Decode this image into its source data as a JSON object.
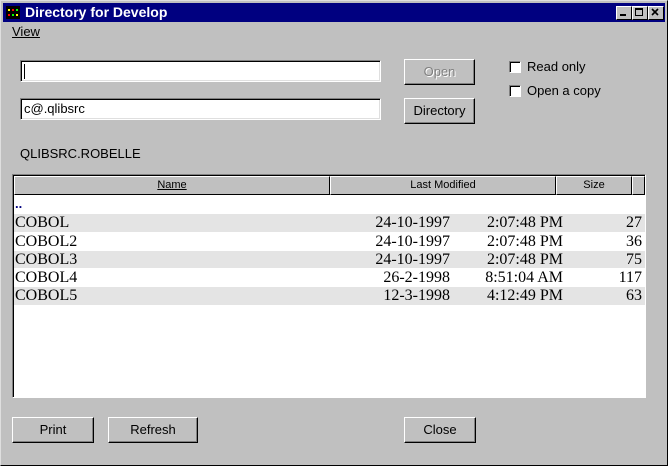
{
  "window": {
    "title": "Directory for Develop"
  },
  "menu": {
    "view_label": "View"
  },
  "inputs": {
    "file_value": "",
    "directory_value": "c@.qlibsrc"
  },
  "buttons": {
    "open": "Open",
    "directory": "Directory",
    "print": "Print",
    "refresh": "Refresh",
    "close": "Close"
  },
  "checkboxes": {
    "read_only": {
      "label": "Read only",
      "checked": false
    },
    "open_copy": {
      "label": "Open a copy",
      "checked": false
    }
  },
  "path_label": "QLIBSRC.ROBELLE",
  "list": {
    "headers": {
      "name": "Name",
      "modified": "Last Modified",
      "size": "Size"
    },
    "parent_entry": "..",
    "rows": [
      {
        "name": "COBOL",
        "date": "24-10-1997",
        "time": "2:07:48 PM",
        "size": "27"
      },
      {
        "name": "COBOL2",
        "date": "24-10-1997",
        "time": "2:07:48 PM",
        "size": "36"
      },
      {
        "name": "COBOL3",
        "date": "24-10-1997",
        "time": "2:07:48 PM",
        "size": "75"
      },
      {
        "name": "COBOL4",
        "date": "26-2-1998",
        "time": "8:51:04 AM",
        "size": "117"
      },
      {
        "name": "COBOL5",
        "date": "12-3-1998",
        "time": "4:12:49 PM",
        "size": "63"
      }
    ]
  },
  "colors": {
    "titlebar": "#000080",
    "face": "#c0c0c0",
    "row_alt": "#e4e4e4"
  }
}
